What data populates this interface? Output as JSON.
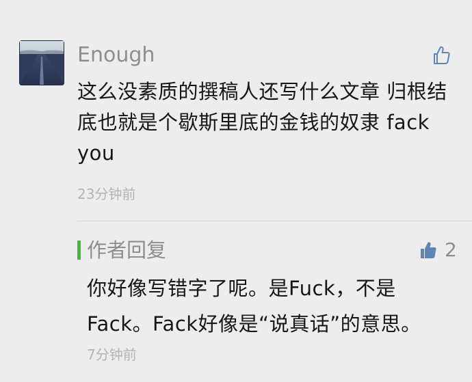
{
  "comment": {
    "avatar_icon": "road-avatar-image",
    "username": "Enough",
    "like_icon": "thumbs-up-outline-icon",
    "text": "这么没素质的撰稿人还写什么文章  归根结底也就是个歇斯里底的金钱的奴隶  fack you",
    "time": "23分钟前"
  },
  "reply": {
    "accent_color": "#3fb838",
    "author_label": "作者回复",
    "like_icon": "thumbs-up-filled-icon",
    "like_color": "#5e84b7",
    "like_count": "2",
    "text": "你好像写错字了呢。是Fuck，不是Fack。Fack好像是“说真话”的意思。",
    "time": "7分钟前"
  }
}
